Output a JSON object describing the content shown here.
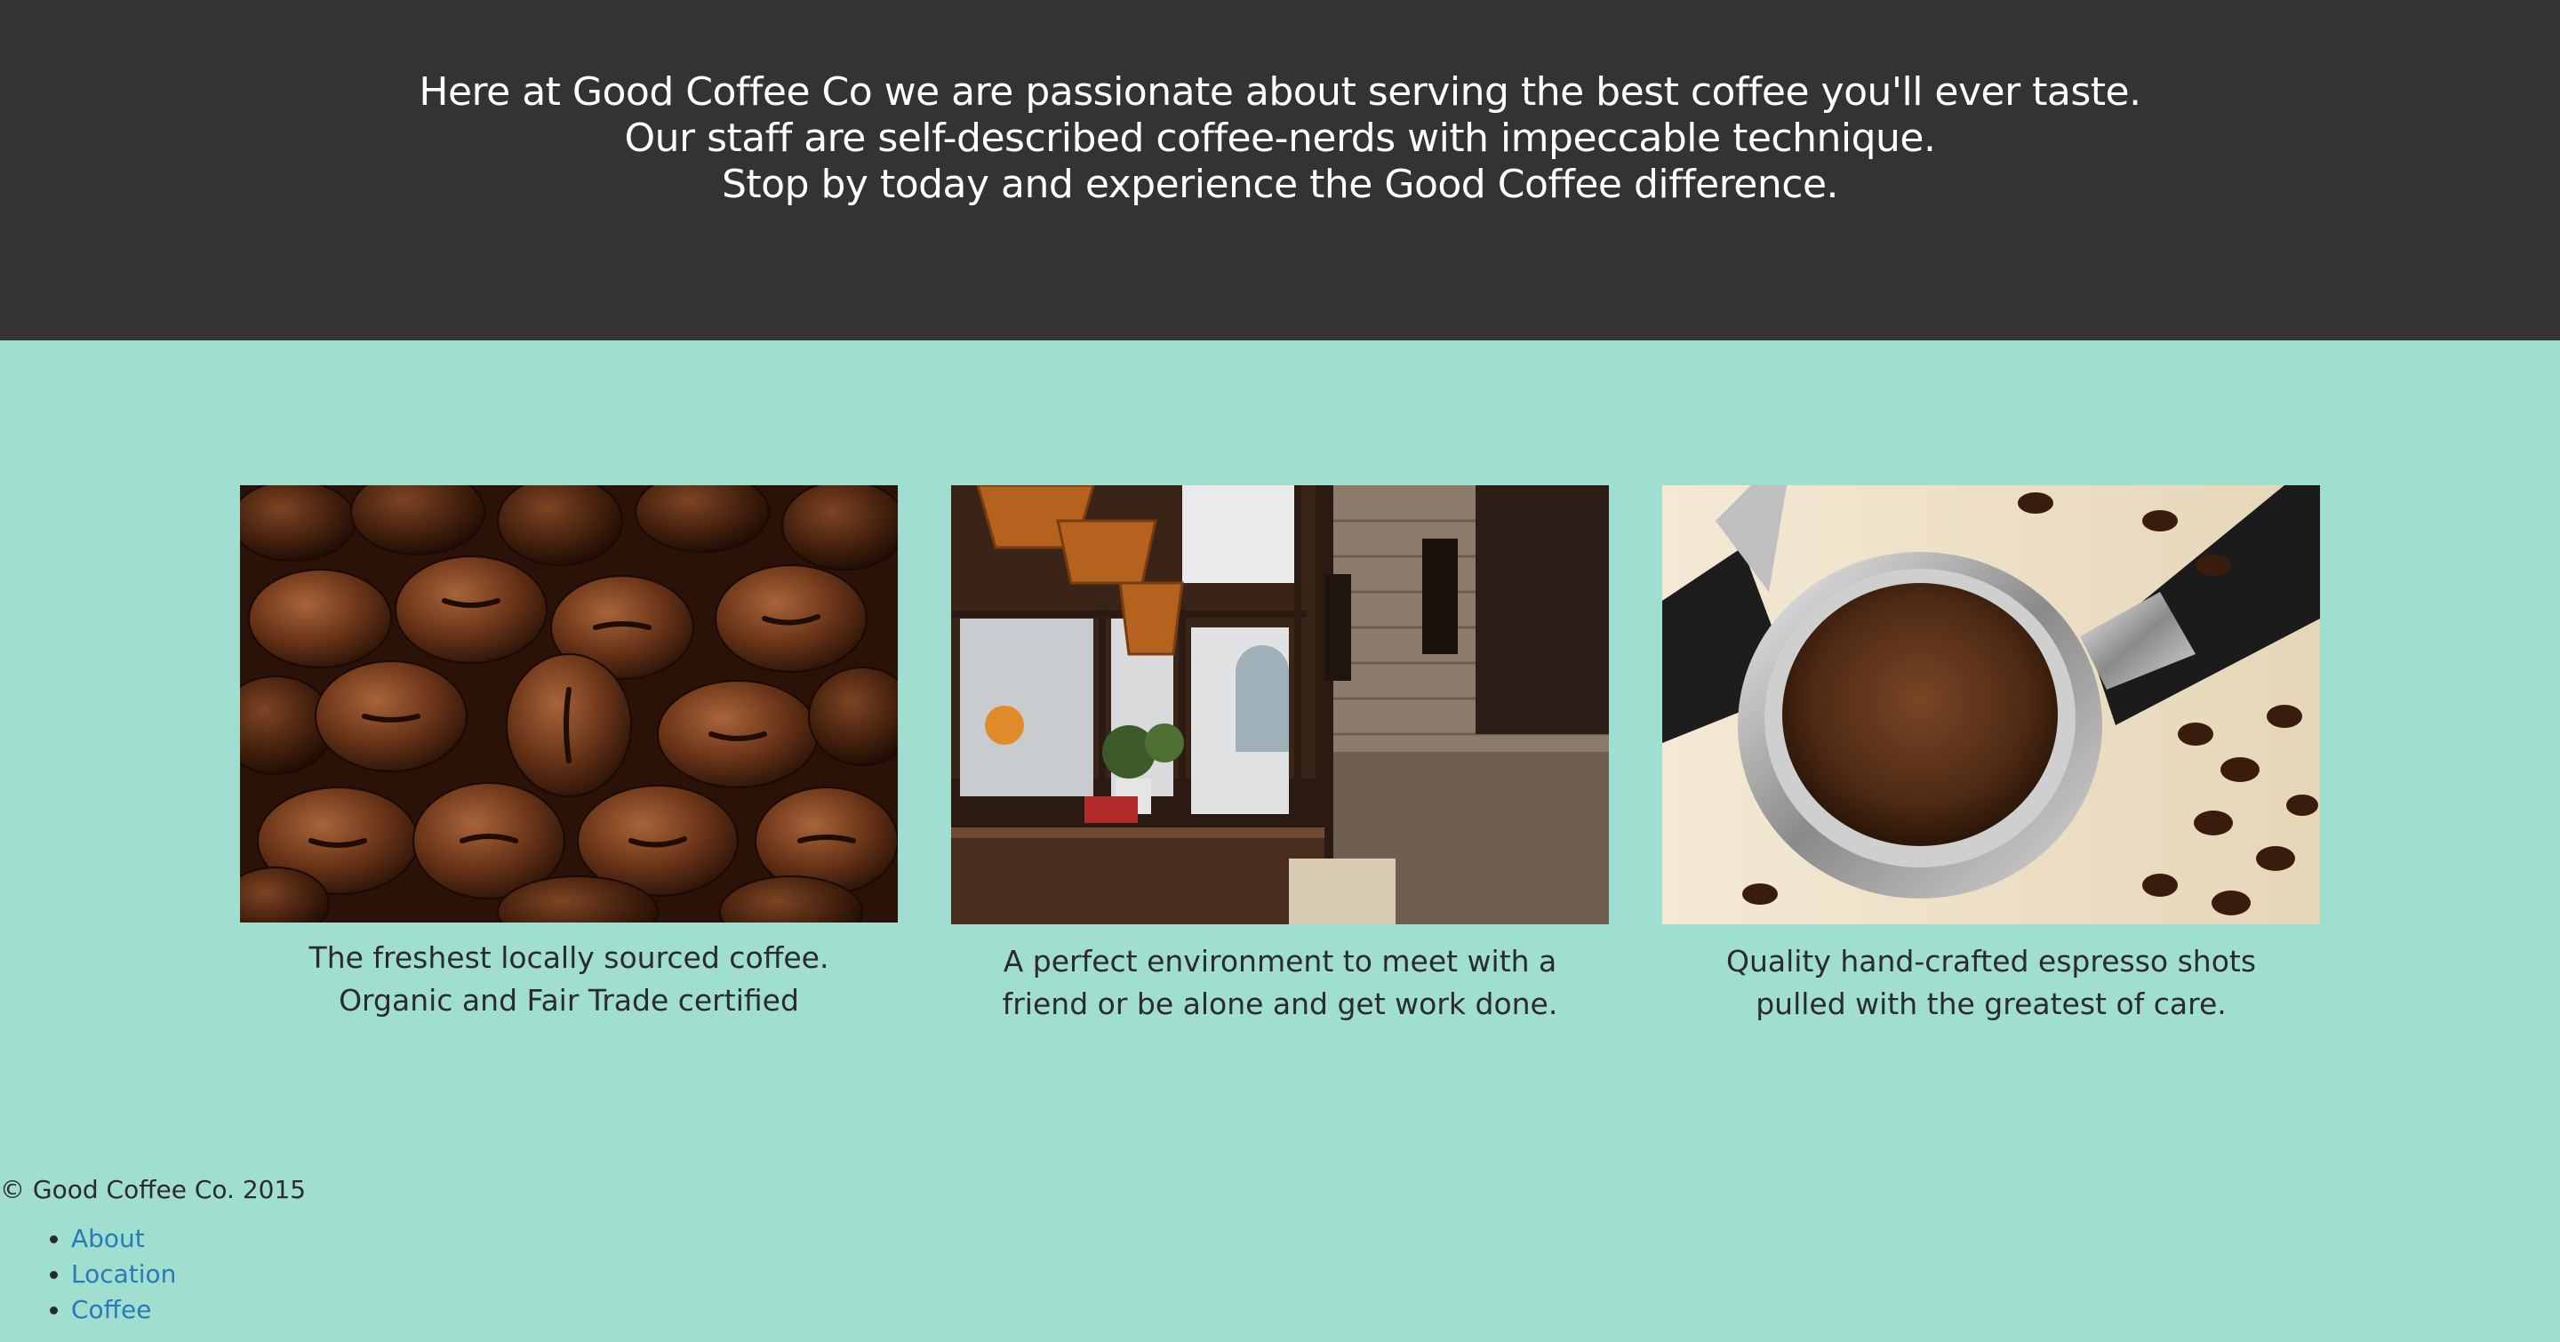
{
  "hero": {
    "lines": [
      "Here at Good Coffee Co we are passionate about serving the best coffee you'll ever taste.",
      "Our staff are self-described coffee-nerds with impeccable technique.",
      "Stop by today and experience the Good Coffee difference."
    ]
  },
  "features": [
    {
      "image": "coffee-beans-photo",
      "caption": "The freshest locally sourced coffee. Organic and Fair Trade certified"
    },
    {
      "image": "cafe-interior-photo",
      "caption": "A perfect environment to meet with a friend or be alone and get work done."
    },
    {
      "image": "espresso-portafilter-photo",
      "caption": "Quality hand-crafted espresso shots pulled with the greatest of care."
    }
  ],
  "footer": {
    "copyright": "© Good Coffee Co. 2015",
    "nav": [
      {
        "label": "About"
      },
      {
        "label": "Location"
      },
      {
        "label": "Coffee"
      }
    ]
  },
  "colors": {
    "hero_bg": "#333333",
    "page_bg": "#a0dfcf",
    "link": "#2a7ab8",
    "text": "#2b2b2b"
  }
}
